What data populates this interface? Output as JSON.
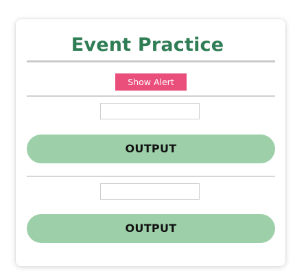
{
  "title": "Event Practice",
  "alert_button": {
    "label": "Show Alert"
  },
  "first_section": {
    "input_value": "",
    "output_button_label": "OUTPUT"
  },
  "second_section": {
    "input_value": "",
    "output_button_label": "OUTPUT"
  },
  "colors": {
    "title": "#2f7d55",
    "alert_button": "#ea4f7c",
    "output_button": "#9dd0a9"
  }
}
